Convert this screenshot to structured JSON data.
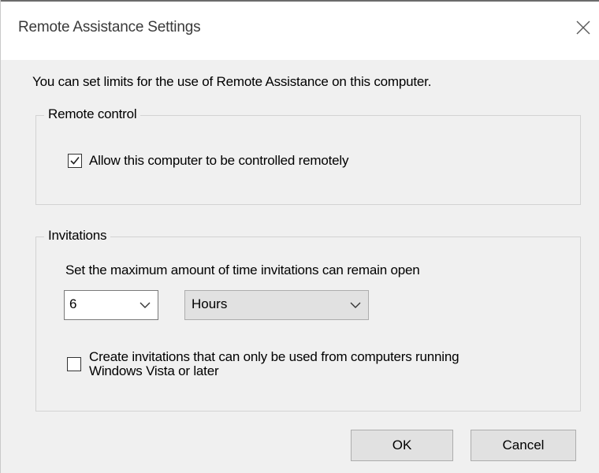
{
  "dialog": {
    "title": "Remote Assistance Settings",
    "close_icon": "close-icon",
    "intro": "You can set limits for the use of Remote Assistance on this computer."
  },
  "remote_control": {
    "legend": "Remote control",
    "allow_label": "Allow this computer to be controlled remotely",
    "allow_checked": true
  },
  "invitations": {
    "legend": "Invitations",
    "max_time_label": "Set the maximum amount of time invitations can remain open",
    "duration_value": "6",
    "duration_unit": "Hours",
    "vista_line1": "Create invitations that can only be used from computers running",
    "vista_line2": "Windows Vista or later",
    "vista_checked": false
  },
  "buttons": {
    "ok": "OK",
    "cancel": "Cancel"
  },
  "colors": {
    "dialog_bg": "#f0f0f0",
    "titlebar_bg": "#ffffff",
    "button_bg": "#e1e1e1",
    "group_border": "#d3d3d3"
  }
}
